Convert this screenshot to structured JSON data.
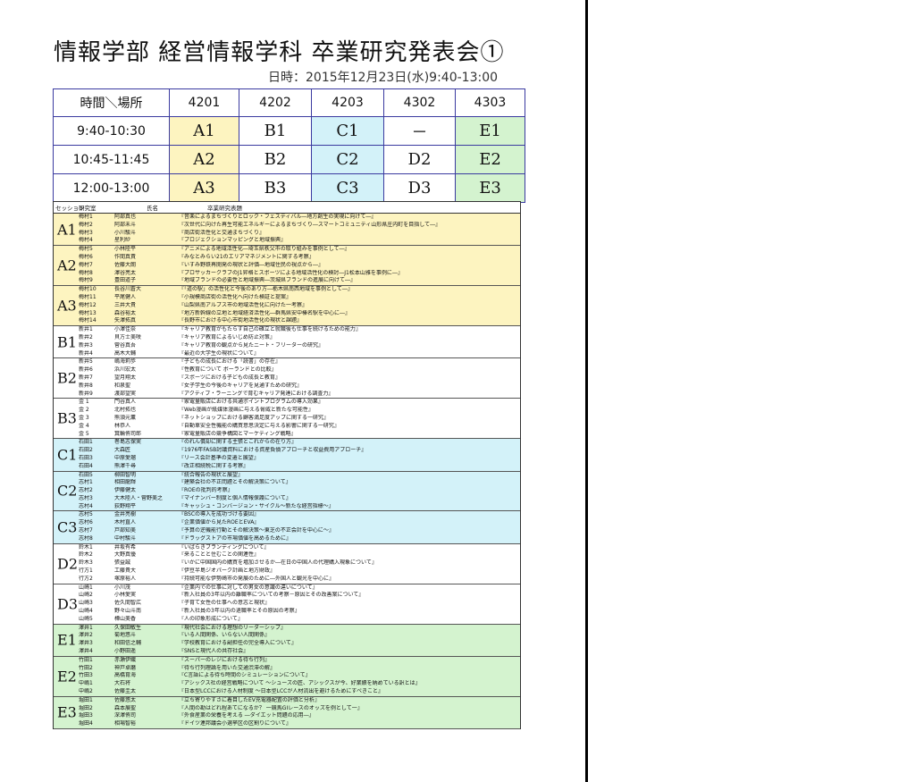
{
  "title": "情報学部 経営情報学科 卒業研究発表会①",
  "date": "日時：2015年12月23日(水)9:40-13:00",
  "schedule": {
    "header": [
      "時間＼場所",
      "4201",
      "4202",
      "4203",
      "4302",
      "4303"
    ],
    "rows": [
      {
        "time": "9:40-10:30",
        "cells": [
          "A1",
          "B1",
          "C1",
          "－",
          "E1"
        ]
      },
      {
        "time": "10:45-11:45",
        "cells": [
          "A2",
          "B2",
          "C2",
          "D2",
          "E2"
        ]
      },
      {
        "time": "12:00-13:00",
        "cells": [
          "A3",
          "B3",
          "C3",
          "D3",
          "E3"
        ]
      }
    ]
  },
  "list_header": {
    "session": "セッション",
    "lab": "研究室",
    "name": "氏名",
    "title": "卒業研究表題"
  },
  "sessions": [
    {
      "label": "A1",
      "color": "A",
      "rows": [
        {
          "lab": "梅村1",
          "name": "阿部真也",
          "title": "『音楽によるまちづくりとロック・フェスティバル―地方創生の実現に向けて―』"
        },
        {
          "lab": "梅村2",
          "name": "阿部未斗",
          "title": "『次世代に向けた再生可能エネルギーによるまちづくり―スマートコミュニティ山形県庄内町を目指して―』"
        },
        {
          "lab": "梅村3",
          "name": "小川駿斗",
          "title": "『商店街活性化と交通まちづくり』"
        },
        {
          "lab": "梅村4",
          "name": "星利紗",
          "title": "『プロジェクションマッピングと地域振興』"
        }
      ]
    },
    {
      "label": "A2",
      "color": "A",
      "rows": [
        {
          "lab": "梅村5",
          "name": "小林陸平",
          "title": "『アニメによる地域活性化―埼玉県秩父市の取り組みを事例として―』"
        },
        {
          "lab": "梅村6",
          "name": "作間真責",
          "title": "『みなとみらい21のエリアマネジメントに関する考察』"
        },
        {
          "lab": "梅村7",
          "name": "佐藤大朗",
          "title": "『いすみ野鉄再開発の現状と評価―地域住民の視点から―』"
        },
        {
          "lab": "梅村8",
          "name": "澤谷亮太",
          "title": "『プロサッカークラブのJ1昇格とスポーツによる地域活性化の検討―J1松本山雅を事例に―』"
        },
        {
          "lab": "梅村9",
          "name": "豊田道子",
          "title": "『地域ブランドの必要性と地域振興―茨城県ブランドの進展に向けて―』"
        }
      ]
    },
    {
      "label": "A3",
      "color": "A",
      "rows": [
        {
          "lab": "梅村10",
          "name": "長谷川蒼大",
          "title": "『「道の駅」の活性化と今後のあり方―栃木県南西地域を事例として―』"
        },
        {
          "lab": "梅村11",
          "name": "平尾健人",
          "title": "『小規模商店街の活性化へ向けた検証と提案』"
        },
        {
          "lab": "梅村12",
          "name": "三井大貴",
          "title": "『山梨県南アルプス市の地域活性化に向けた一考察』"
        },
        {
          "lab": "梅村13",
          "name": "森谷裕太",
          "title": "『地方新幹線の立地と地域経済活性化―群馬県安中榛名駅を中心に―』"
        },
        {
          "lab": "梅村14",
          "name": "矢澤拓真",
          "title": "『長野市における中心市街地活性化の現状と課題』"
        }
      ]
    },
    {
      "label": "B1",
      "color": "B",
      "rows": [
        {
          "lab": "新井1",
          "name": "小澤佳奈",
          "title": "『キャリア教育がもたらす自己の確立と就職後も仕事を続けるための能力』"
        },
        {
          "lab": "新井2",
          "name": "貝方士美咲",
          "title": "『キャリア教育によるいじめ防止対策』"
        },
        {
          "lab": "新井3",
          "name": "菅谷真吾",
          "title": "『キャリア教育の観点から見たニート・フリーターの研究』"
        },
        {
          "lab": "新井4",
          "name": "高木大輔",
          "title": "『最近の大学生の現状について』"
        }
      ]
    },
    {
      "label": "B2",
      "color": "B",
      "rows": [
        {
          "lab": "新井5",
          "name": "嶋海莉歩",
          "title": "『子どもの成長における「読書」の存在』"
        },
        {
          "lab": "新井6",
          "name": "浜川宏太",
          "title": "『性教育について ボーランドとの比較』"
        },
        {
          "lab": "新井7",
          "name": "望月翔太",
          "title": "『スポーツにおける子どもの成長と教育』"
        },
        {
          "lab": "新井8",
          "name": "和泉聖",
          "title": "『女子学生の今後のキャリアを見通すための研究』"
        },
        {
          "lab": "新井9",
          "name": "渡部望実",
          "title": "『アクティブ・ラーニングで育むキャリア発達における調査力』"
        }
      ]
    },
    {
      "label": "B3",
      "color": "B",
      "rows": [
        {
          "lab": "金 1",
          "name": "門谷真人",
          "title": "『家電量販店における共通ポイントプログラムの導入効果』"
        },
        {
          "lab": "金 2",
          "name": "北村拓也",
          "title": "『Web漫画が紙媒体漫画に与える脅威と新たな可能性』"
        },
        {
          "lab": "金 3",
          "name": "熊須元薫",
          "title": "『ネットショップにおける顧客満足度アップに関する一研究』"
        },
        {
          "lab": "金 4",
          "name": "林恭人",
          "title": "『自動車安全性機能の購買意思決定に与える影響に関する一研究』"
        },
        {
          "lab": "金 5",
          "name": "箕輪侑司郎",
          "title": "『家電量販店の競争構図とマーケティング戦略』"
        }
      ]
    },
    {
      "label": "C1",
      "color": "C",
      "rows": [
        {
          "lab": "石田1",
          "name": "巻島志保実",
          "title": "『のれん償却に関する主張とこれからの在り方』"
        },
        {
          "lab": "石田2",
          "name": "大森匠",
          "title": "『1976年FASB討議資料における資産負債アプローチと収益費用アプローチ』"
        },
        {
          "lab": "石田3",
          "name": "中原愛瑠",
          "title": "『リース会計基準の変遷と展望』"
        },
        {
          "lab": "石田4",
          "name": "熊澤千尋",
          "title": "『改正相続税に関する考察』"
        }
      ]
    },
    {
      "label": "C2",
      "color": "C",
      "rows": [
        {
          "lab": "石田5",
          "name": "柳田智明",
          "title": "『統合報告の現状と展望』"
        },
        {
          "lab": "志村1",
          "name": "相田龍輝",
          "title": "『建築会社の不正問題とその解決策について』"
        },
        {
          "lab": "志村2",
          "name": "伊藤健太",
          "title": "『ROEの批判的考察』"
        },
        {
          "lab": "志村3",
          "name": "大木陸人・菅野美之",
          "title": "『マイナンバー制度と個人情報保護について』"
        },
        {
          "lab": "志村4",
          "name": "荻野翔平",
          "title": "『キャッシュ・コンバージョン・サイクル～新たな経営指標～』"
        }
      ]
    },
    {
      "label": "C3",
      "color": "C",
      "rows": [
        {
          "lab": "志村5",
          "name": "金井亮樹",
          "title": "『BSCの導入を成功づける要因』"
        },
        {
          "lab": "志村6",
          "name": "木村直人",
          "title": "『企業価値から見たROEとEVA』"
        },
        {
          "lab": "志村7",
          "name": "戸部知美",
          "title": "『予算の逆機能行動とその解決策～東芝の不正会計を中心に～』"
        },
        {
          "lab": "志村8",
          "name": "中村駿斗",
          "title": "『ドラッグストアの市場価値を高めるために』"
        }
      ]
    },
    {
      "label": "D2",
      "color": "D",
      "rows": [
        {
          "lab": "鈴木1",
          "name": "井坂有希",
          "title": "『いばらきブランディングについて』"
        },
        {
          "lab": "鈴木2",
          "name": "大野真優",
          "title": "『来ることと住むことの関連性』"
        },
        {
          "lab": "鈴木3",
          "name": "張益誠",
          "title": "『いかに中国国内の購買を増加させるか―在日の中国人の代理購入現象について』"
        },
        {
          "lab": "行方1",
          "name": "工藤貴大",
          "title": "『伊豆半島ジオパーク計画と地方財政』"
        },
        {
          "lab": "行方2",
          "name": "塚原裕人",
          "title": "『持続可能な伊勢崎市の発展のために―外国人と観光を中心に』"
        }
      ]
    },
    {
      "label": "D3",
      "color": "D",
      "rows": [
        {
          "lab": "山崎1",
          "name": "小川茂",
          "title": "『企業内での仕事に対しての男女の意識の違いについて』"
        },
        {
          "lab": "山崎2",
          "name": "小林愛実",
          "title": "『新入社員の3年以内の離職率についての考察－原因とその改善案について』"
        },
        {
          "lab": "山崎3",
          "name": "佐久間智広",
          "title": "『子育て女性の仕事への意志と現状』"
        },
        {
          "lab": "山崎4",
          "name": "野々山斗南",
          "title": "『新入社員の3年以内の退職率とその原因の考察』"
        },
        {
          "lab": "山崎5",
          "name": "樺山美香",
          "title": "『人の印象形成について』"
        }
      ]
    },
    {
      "label": "E1",
      "color": "E",
      "rows": [
        {
          "lab": "澤井1",
          "name": "久保田敏生",
          "title": "『現代社会における理想のリーダーシップ』"
        },
        {
          "lab": "澤井2",
          "name": "菊地悠斗",
          "title": "『いる人間関係、いらない人間関係』"
        },
        {
          "lab": "澤井3",
          "name": "和田信之輔",
          "title": "『学校教育における副担任の完全導入について』"
        },
        {
          "lab": "澤井4",
          "name": "小野田遥",
          "title": "『SNSと現代人の共存社会』"
        }
      ]
    },
    {
      "label": "E2",
      "color": "E",
      "rows": [
        {
          "lab": "竹田1",
          "name": "赤瀬伊織",
          "title": "『スーパーのレジにおける待ち行列』"
        },
        {
          "lab": "竹田2",
          "name": "神戸卓磨",
          "title": "『待ち行列理論を用いた交通渋滞の解』"
        },
        {
          "lab": "竹田3",
          "name": "高橋育海",
          "title": "『C言語による待ち時間のシミュレーションについて』"
        },
        {
          "lab": "中嶋1",
          "name": "大石将",
          "title": "『アシックス社の経営戦略について ～シューズの匠、アシックスが今、好業績を納めている訳とは』"
        },
        {
          "lab": "中嶋2",
          "name": "佐藤圭太",
          "title": "『日本型LCCにおける人材制度 ～日本型LCCが人材流出を避けるためにすべきこと』"
        }
      ]
    },
    {
      "label": "E3",
      "color": "E",
      "rows": [
        {
          "lab": "堀田1",
          "name": "佐藤悠太",
          "title": "『立ち寄りやすさに着目したEV充電器配置の評価と分析』"
        },
        {
          "lab": "堀田2",
          "name": "森本展聖",
          "title": "『人間の勘はどれ程あてになるか？ 一競馬GIレースのオッズを例として一』"
        },
        {
          "lab": "堀田3",
          "name": "深澤侑司",
          "title": "『外食産業の栄養を考える ―ダイエット問題の応用―』"
        },
        {
          "lab": "堀田4",
          "name": "相場智裕",
          "title": "『ドイツ連邦議会小選挙区の区割りについて』"
        }
      ]
    }
  ]
}
